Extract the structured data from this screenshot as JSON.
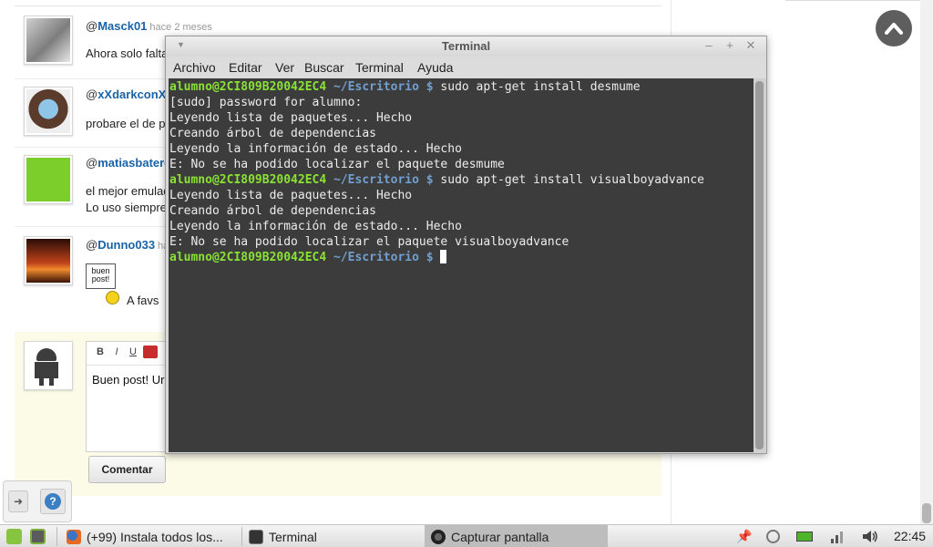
{
  "page": {
    "comments": [
      {
        "at": "@",
        "author": "Masck01",
        "time": "hace 2 meses",
        "text": "Ahora solo falta"
      },
      {
        "at": "@",
        "author": "xXdarkconX",
        "time": "",
        "text": "probare el de p"
      },
      {
        "at": "@",
        "author": "matiasbaterd",
        "time": "",
        "text": "el mejor emulad",
        "text2": "Lo uso siempre"
      },
      {
        "at": "@",
        "author": "Dunno033",
        "time": "ha",
        "sign_text": "buen post!",
        "text": "A favs"
      }
    ],
    "reply": {
      "toolbar": [
        "B",
        "I",
        "U"
      ],
      "text": "Buen post! Ur",
      "submit_label": "Comentar"
    }
  },
  "terminal": {
    "title": "Terminal",
    "menu": [
      "Archivo",
      "Editar",
      "Ver",
      "Buscar",
      "Terminal",
      "Ayuda"
    ],
    "prompt_user": "alumno@2CI809B20042EC4",
    "prompt_path": " ~/Escritorio $",
    "lines": [
      {
        "type": "prompt",
        "cmd": " sudo apt-get install desmume"
      },
      {
        "type": "out",
        "text": "[sudo] password for alumno:"
      },
      {
        "type": "out",
        "text": "Leyendo lista de paquetes... Hecho"
      },
      {
        "type": "out",
        "text": "Creando árbol de dependencias"
      },
      {
        "type": "out",
        "text": "Leyendo la información de estado... Hecho"
      },
      {
        "type": "out",
        "text": "E: No se ha podido localizar el paquete desmume"
      },
      {
        "type": "prompt",
        "cmd": " sudo apt-get install visualboyadvance"
      },
      {
        "type": "out",
        "text": "Leyendo lista de paquetes... Hecho"
      },
      {
        "type": "out",
        "text": "Creando árbol de dependencias"
      },
      {
        "type": "out",
        "text": "Leyendo la información de estado... Hecho"
      },
      {
        "type": "out",
        "text": "E: No se ha podido localizar el paquete visualboyadvance"
      },
      {
        "type": "prompt",
        "cmd": " ",
        "cursor": true
      }
    ]
  },
  "taskbar": {
    "tasks": [
      {
        "label": "(+99) Instala todos los...",
        "icon": "firefox-icon",
        "active": false
      },
      {
        "label": "Terminal",
        "icon": "terminal-icon",
        "active": false
      },
      {
        "label": "Capturar pantalla",
        "icon": "screenshot-icon",
        "active": true
      }
    ],
    "clock": "22:45"
  },
  "colors": {
    "prompt_user": "#8ae234",
    "prompt_path": "#729fcf",
    "terminal_bg": "#3c3c3c",
    "link": "#1a63a8"
  }
}
